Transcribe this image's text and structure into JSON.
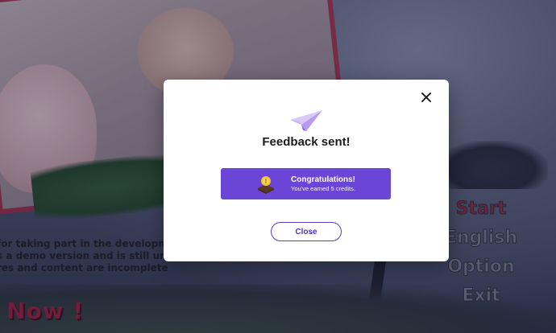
{
  "background": {
    "notice_lines": [
      "for taking part in the developme",
      "s a demo version and is still unde",
      "res and content are incomplete"
    ],
    "cta_text": "Now !",
    "menu": [
      {
        "label": "Start",
        "active": true
      },
      {
        "label": "English",
        "active": false
      },
      {
        "label": "Option",
        "active": false
      },
      {
        "label": "Exit",
        "active": false
      }
    ]
  },
  "modal": {
    "icon": "paper-plane-icon",
    "title": "Feedback sent!",
    "reward": {
      "icon": "coin-reward-icon",
      "headline": "Congratulations!",
      "subtext": "You've earned 5 credits."
    },
    "close_button_label": "Close",
    "close_icon": "close-icon"
  },
  "colors": {
    "accent": "#6b45d6",
    "accent_border": "#5b3bd0",
    "menu_active": "#8e2a45"
  }
}
